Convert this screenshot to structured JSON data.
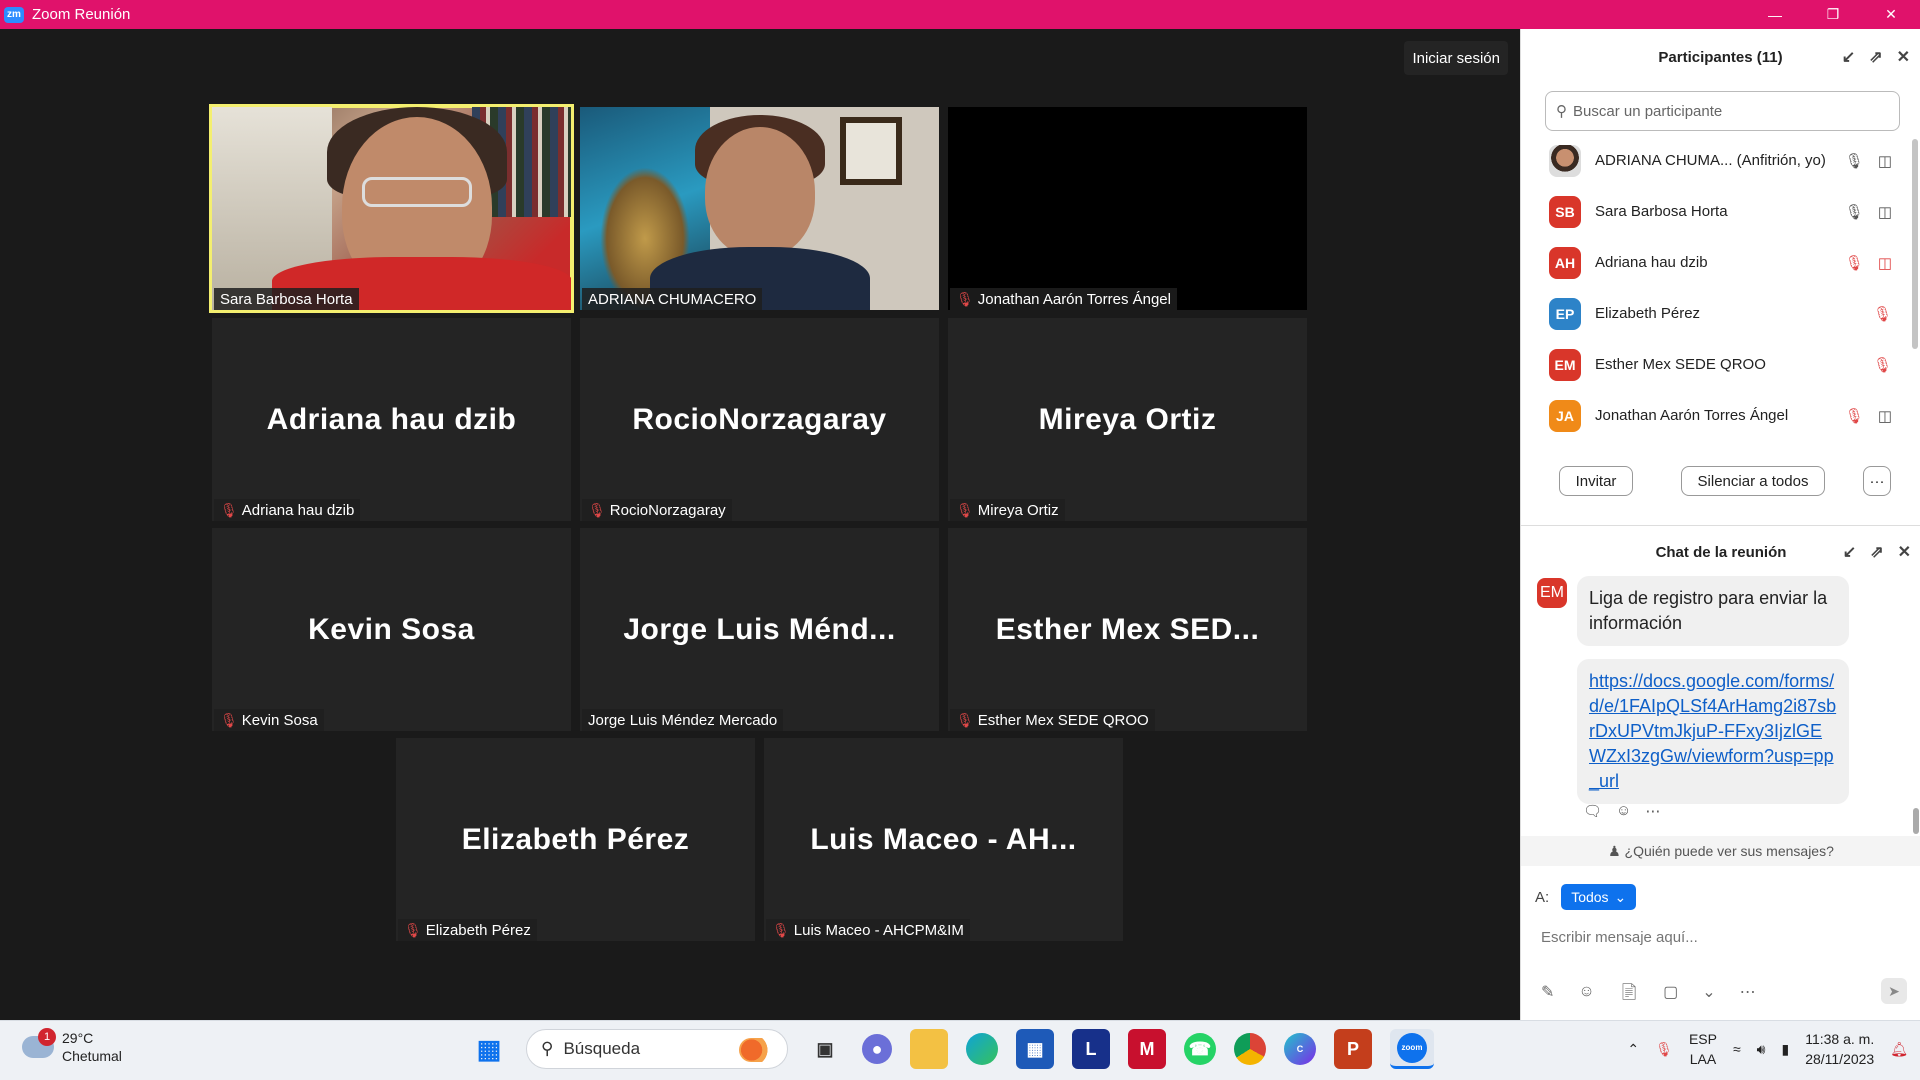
{
  "window": {
    "title": "Zoom Reunión",
    "logo_text": "zm"
  },
  "meeting": {
    "signin_label": "Iniciar sesión",
    "tiles": [
      {
        "label": "Sara Barbosa Horta",
        "big_name": "",
        "muted": false,
        "video": "sara"
      },
      {
        "label": "ADRIANA CHUMACERO",
        "big_name": "",
        "muted": false,
        "video": "adriana"
      },
      {
        "label": "Jonathan Aarón Torres Ángel",
        "big_name": "",
        "muted": true,
        "video": "black"
      },
      {
        "label": "Adriana hau dzib",
        "big_name": "Adriana hau dzib",
        "muted": true
      },
      {
        "label": "RocioNorzagaray",
        "big_name": "RocioNorzagaray",
        "muted": true
      },
      {
        "label": "Mireya Ortiz",
        "big_name": "Mireya Ortiz",
        "muted": true
      },
      {
        "label": "Kevin Sosa",
        "big_name": "Kevin Sosa",
        "muted": true
      },
      {
        "label": "Jorge Luis Méndez Mercado",
        "big_name": "Jorge  Luis  Ménd...",
        "muted": false
      },
      {
        "label": "Esther Mex SEDE QROO",
        "big_name": "Esther  Mex  SED...",
        "muted": true
      },
      {
        "label": "Elizabeth Pérez",
        "big_name": "Elizabeth Pérez",
        "muted": true
      },
      {
        "label": "Luis Maceo - AHCPM&IM",
        "big_name": "Luis  Maceo  -  AH...",
        "muted": true
      }
    ]
  },
  "participants": {
    "title": "Participantes (11)",
    "search_placeholder": "Buscar un participante",
    "items": [
      {
        "initials": "",
        "name": "ADRIANA CHUMA... (Anfitrión, yo)",
        "color": "",
        "mic": "on",
        "video": "on"
      },
      {
        "initials": "SB",
        "name": "Sara Barbosa Horta",
        "color": "#d9362a",
        "mic": "on",
        "video": "on"
      },
      {
        "initials": "AH",
        "name": "Adriana hau dzib",
        "color": "#d9362a",
        "mic": "muted",
        "video": "off"
      },
      {
        "initials": "EP",
        "name": "Elizabeth Pérez",
        "color": "#2d83c8",
        "mic": "muted",
        "video": "none"
      },
      {
        "initials": "EM",
        "name": "Esther Mex SEDE QROO",
        "color": "#d9362a",
        "mic": "muted",
        "video": "none"
      },
      {
        "initials": "JA",
        "name": "Jonathan Aarón Torres Ángel",
        "color": "#f08a18",
        "mic": "muted",
        "video": "on"
      }
    ],
    "invite_label": "Invitar",
    "mute_all_label": "Silenciar a todos",
    "more_label": "···"
  },
  "chat": {
    "title": "Chat de la reunión",
    "sender_initials": "EM",
    "message_text": "Liga de registro para enviar la información",
    "message_link": "https://docs.google.com/forms/d/e/1FAIpQLSf4ArHamg2i87sbrDxUPVtmJkjuP-FFxy3IjzlGEWZxI3zgGw/viewform?usp=pp_url",
    "who_can_see": "¿Quién puede ver sus mensajes?",
    "to_label": "A:",
    "recipient": "Todos",
    "input_placeholder": "Escribir mensaje aquí..."
  },
  "taskbar": {
    "weather_badge": "1",
    "temperature": "29°C",
    "location": "Chetumal",
    "search_label": "Búsqueda",
    "language_top": "ESP",
    "language_bottom": "LAA",
    "time": "11:38 a. m.",
    "date": "28/11/2023",
    "apps": [
      "windows-start",
      "task-view",
      "chat",
      "file-explorer",
      "edge",
      "store",
      "l-app",
      "mcafee",
      "whatsapp",
      "chrome",
      "canva",
      "powerpoint",
      "zoom"
    ]
  },
  "colors": {
    "titlebar": "#e0126b",
    "accent": "#0e72ed",
    "active_speaker": "#f4ef6f",
    "muted_red": "#e04848"
  }
}
